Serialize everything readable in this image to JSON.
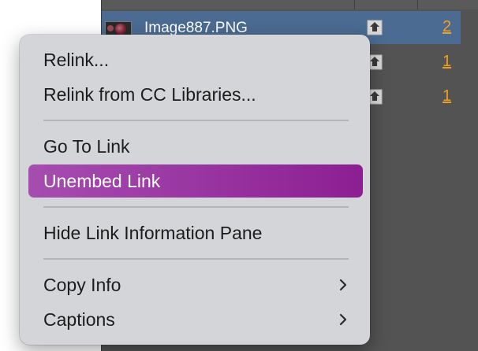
{
  "links_panel": {
    "rows": [
      {
        "name": "Image887.PNG",
        "page": "2",
        "selected": true
      },
      {
        "name": "",
        "page": "1",
        "selected": false
      },
      {
        "name": "",
        "page": "1",
        "selected": false
      }
    ]
  },
  "context_menu": {
    "items": [
      {
        "label": "Relink..."
      },
      {
        "label": "Relink from CC Libraries..."
      },
      {
        "label": "Go To Link"
      },
      {
        "label": "Unembed Link",
        "highlighted": true
      },
      {
        "label": "Hide Link Information Pane"
      },
      {
        "label": "Copy Info",
        "submenu": true
      },
      {
        "label": "Captions",
        "submenu": true
      }
    ]
  },
  "colors": {
    "highlight": "#8c1f92",
    "page_link": "#f0a020",
    "selected_row": "#4b6b92"
  },
  "icons": {
    "embedded": "embedded-link-icon",
    "submenu": "chevron-right-icon"
  }
}
